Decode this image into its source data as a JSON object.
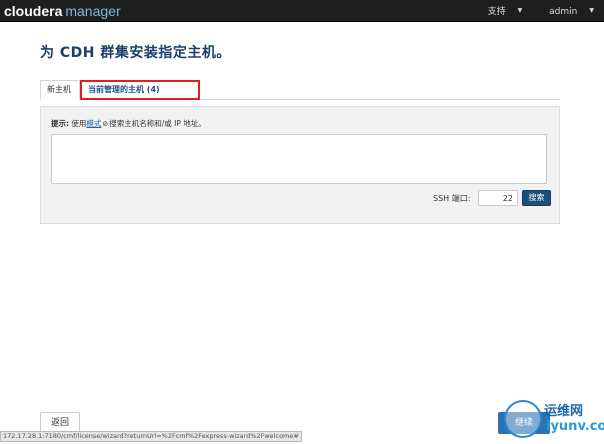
{
  "header": {
    "brand_main": "cloudera",
    "brand_sub": "manager",
    "nav_support": "支持",
    "nav_user": "admin"
  },
  "page": {
    "title": "为 CDH 群集安装指定主机。"
  },
  "tabs": [
    {
      "label": "新主机",
      "active": true
    },
    {
      "label": "当前管理的主机 (4)",
      "active": false
    }
  ],
  "hint": {
    "prefix": "提示:",
    "text_before": " 使用",
    "link": "模式",
    "text_after": "搜索主机名称和/或 IP 地址。"
  },
  "host_input": {
    "value": "",
    "placeholder": ""
  },
  "ssh": {
    "label": "SSH 端口:",
    "port": "22"
  },
  "buttons": {
    "search": "搜索",
    "back": "返回",
    "continue": "继续"
  },
  "statusbar": {
    "url": "172.17.28.1:7180/cmf/license/wizard?returnUrl=%2Fcmf%2Fexpress-wizard%2Fwelcome#"
  },
  "watermark": {
    "line1": "运维网",
    "line2": "iyunv.com"
  }
}
